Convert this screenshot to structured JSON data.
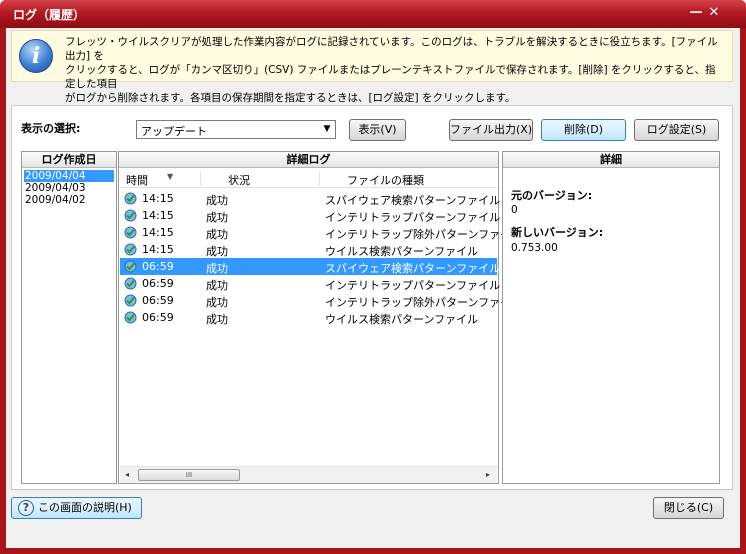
{
  "window": {
    "title": "ログ（履歴）",
    "minimize_glyph": "—",
    "close_glyph": "✕"
  },
  "info": {
    "icon": "info-icon",
    "icon_glyph": "i",
    "lines": [
      "フレッツ・ウイルスクリアが処理した作業内容がログに記録されています。このログは、トラブルを解決するときに役立ちます。[ファイル出力] を",
      "クリックすると、ログが「カンマ区切り」(CSV) ファイルまたはプレーンテキストファイルで保存されます。[削除] をクリックすると、指定した項目",
      "がログから削除されます。各項目の保存期間を指定するときは、[ログ設定] をクリックします。"
    ]
  },
  "toolbar": {
    "select_label": "表示の選択:",
    "select_value": "アップデート",
    "show_button": "表示(V)",
    "export_button": "ファイル出力(X)",
    "delete_button": "削除(D)",
    "log_settings_button": "ログ設定(S)"
  },
  "dates_pane": {
    "header": "ログ作成日",
    "items": [
      "2009/04/04",
      "2009/04/03",
      "2009/04/02"
    ],
    "selected_index": 0
  },
  "log_pane": {
    "header": "詳細ログ",
    "columns": [
      "時間",
      "状況",
      "ファイルの種類"
    ],
    "rows": [
      {
        "time": "14:15",
        "status": "成功",
        "type": "スパイウェア検索パターンファイル"
      },
      {
        "time": "14:15",
        "status": "成功",
        "type": "インテリトラップパターンファイル"
      },
      {
        "time": "14:15",
        "status": "成功",
        "type": "インテリトラップ除外パターンファイル"
      },
      {
        "time": "14:15",
        "status": "成功",
        "type": "ウイルス検索パターンファイル"
      },
      {
        "time": "06:59",
        "status": "成功",
        "type": "スパイウェア検索パターンファイル"
      },
      {
        "time": "06:59",
        "status": "成功",
        "type": "インテリトラップパターンファイル"
      },
      {
        "time": "06:59",
        "status": "成功",
        "type": "インテリトラップ除外パターンファイル"
      },
      {
        "time": "06:59",
        "status": "成功",
        "type": "ウイルス検索パターンファイル"
      }
    ],
    "selected_row": 4,
    "row_icon": "success-update-icon",
    "sort_glyph": "▼",
    "scroll_left_glyph": "◂",
    "scroll_right_glyph": "▸",
    "scroll_thumb_glyph": "III"
  },
  "detail_pane": {
    "header": "詳細",
    "old_version_label": "元のバージョン:",
    "old_version_value": "0",
    "new_version_label": "新しいバージョン:",
    "new_version_value": "0.753.00"
  },
  "footer": {
    "help_button": "この画面の説明(H)",
    "help_icon_glyph": "?",
    "close_button": "閉じる(C)"
  },
  "colors": {
    "title_bar": "#b21a23",
    "selection": "#3399ff",
    "info_background": "#fffbe1"
  }
}
